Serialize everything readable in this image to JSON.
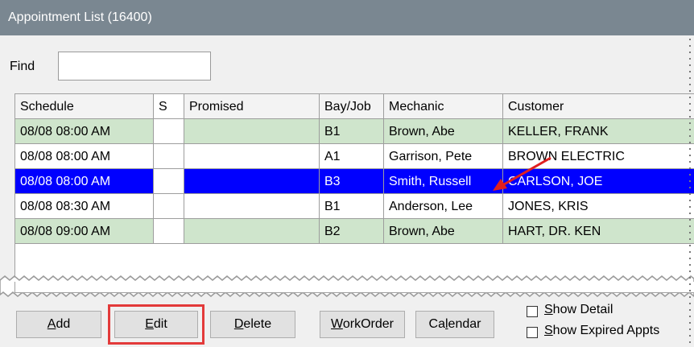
{
  "window": {
    "title": "Appointment List (16400)"
  },
  "find": {
    "label": "Find",
    "value": ""
  },
  "grid": {
    "columns": [
      "Schedule",
      "S",
      "Promised",
      "Bay/Job",
      "Mechanic",
      "Customer"
    ],
    "rows": [
      {
        "schedule": "08/08 08:00 AM",
        "s": "",
        "promised": "",
        "bay": "B1",
        "mechanic": "Brown, Abe",
        "customer": "KELLER, FRANK"
      },
      {
        "schedule": "08/08 08:00 AM",
        "s": "",
        "promised": "",
        "bay": "A1",
        "mechanic": "Garrison, Pete",
        "customer": "BROWN ELECTRIC"
      },
      {
        "schedule": "08/08 08:00 AM",
        "s": "",
        "promised": "",
        "bay": "B3",
        "mechanic": "Smith, Russell",
        "customer": "CARLSON, JOE"
      },
      {
        "schedule": "08/08 08:30 AM",
        "s": "",
        "promised": "",
        "bay": "B1",
        "mechanic": "Anderson, Lee",
        "customer": "JONES, KRIS"
      },
      {
        "schedule": "08/08 09:00 AM",
        "s": "",
        "promised": "",
        "bay": "B2",
        "mechanic": "Brown, Abe",
        "customer": "HART, DR. KEN"
      }
    ]
  },
  "buttons": {
    "add": {
      "label": "Add",
      "accel": "A",
      "rest": "dd"
    },
    "edit": {
      "label": "Edit",
      "accel": "E",
      "rest": "dit"
    },
    "delete": {
      "label": "Delete",
      "accel": "D",
      "rest": "elete"
    },
    "workorder": {
      "label": "WorkOrder",
      "accel": "W",
      "rest": "orkOrder"
    },
    "calendar": {
      "label": "Calendar",
      "pre": "Ca",
      "accel": "l",
      "rest": "endar"
    }
  },
  "options": {
    "show_detail": {
      "label": "Show Detail",
      "accel": "S",
      "rest": "how Detail",
      "checked": false
    },
    "show_expired": {
      "label": "Show Expired Appts",
      "accel": "S",
      "rest": "how Expired Appts",
      "checked": false
    }
  },
  "colors": {
    "titlebar": "#7a8791",
    "row_green": "#cfe5cc",
    "row_selected": "#0000ff",
    "highlight": "#e33a3a"
  }
}
